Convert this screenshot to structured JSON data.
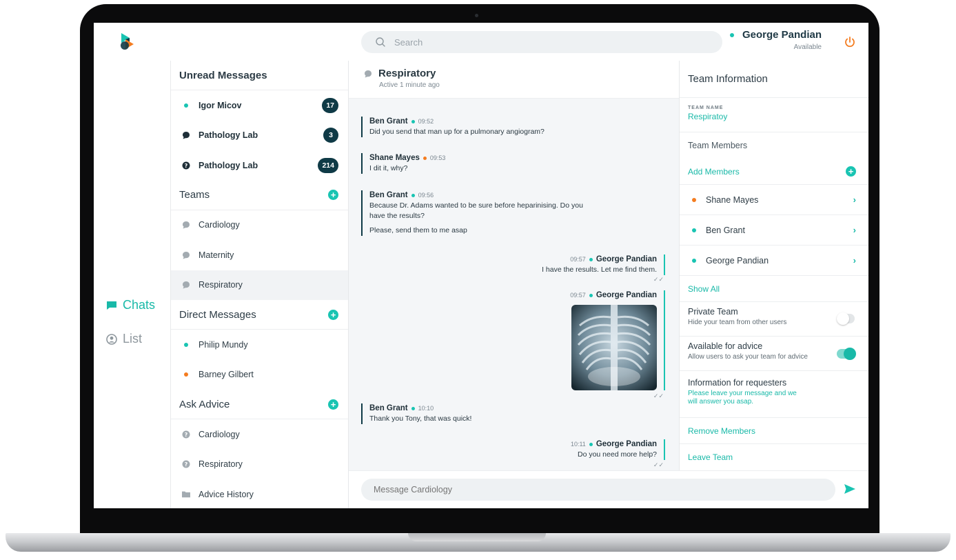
{
  "header": {
    "search_placeholder": "Search",
    "user_name": "George Pandian",
    "user_status": "Available"
  },
  "rail": {
    "chats_label": "Chats",
    "list_label": "List"
  },
  "unread": {
    "title": "Unread Messages",
    "items": [
      {
        "label": "Igor Micov",
        "badge": "17",
        "icon": "teal-dot"
      },
      {
        "label": "Pathology Lab",
        "badge": "3",
        "icon": "chat-bubble-icon"
      },
      {
        "label": "Pathology Lab",
        "badge": "214",
        "icon": "question-icon"
      }
    ]
  },
  "teams": {
    "title": "Teams",
    "items": [
      {
        "label": "Cardiology"
      },
      {
        "label": "Maternity"
      },
      {
        "label": "Respiratory"
      }
    ]
  },
  "direct": {
    "title": "Direct Messages",
    "items": [
      {
        "label": "Philip Mundy",
        "status_color": "#19c4b2"
      },
      {
        "label": "Barney Gilbert",
        "status_color": "#f47c20"
      }
    ]
  },
  "advice": {
    "title": "Ask Advice",
    "items": [
      {
        "label": "Cardiology"
      },
      {
        "label": "Respiratory"
      },
      {
        "label": "Advice History"
      }
    ]
  },
  "chat": {
    "title": "Respiratory",
    "subtitle": "Active 1 minute ago",
    "messages": [
      {
        "author": "Ben Grant",
        "time": "09:52",
        "text": "Did you send that man up for a pulmonary angiogram?"
      },
      {
        "author": "Shane Mayes",
        "time": "09:53",
        "text": "I dit it, why?"
      },
      {
        "author": "Ben Grant",
        "time": "09:56",
        "text1": "Because Dr. Adams wanted to be sure before heparinising. Do you",
        "text2": "have the results?",
        "text3": "Please, send them to me asap"
      },
      {
        "author": "George Pandian",
        "time": "09:57",
        "text": "I have the results. Let me find them."
      },
      {
        "author": "George Pandian",
        "time": "09:57"
      },
      {
        "author": "Ben Grant",
        "time": "10:10",
        "text": "Thank you Tony, that was quick!"
      },
      {
        "author": "George Pandian",
        "time": "10:11",
        "text": "Do you need more help?"
      }
    ],
    "composer_placeholder": "Message Cardiology"
  },
  "info": {
    "title": "Team Information",
    "team_name_label": "TEAM NAME",
    "team_name": "Respiratoy",
    "members_title": "Team Members",
    "add_members": "Add Members",
    "members": [
      {
        "name": "Shane Mayes",
        "status_color": "#f47c20"
      },
      {
        "name": "Ben Grant",
        "status_color": "#19c4b2"
      },
      {
        "name": "George Pandian",
        "status_color": "#19c4b2"
      }
    ],
    "show_all": "Show All",
    "private_title": "Private Team",
    "private_desc": "Hide your team from other users",
    "private_on": false,
    "advice_title": "Available for advice",
    "advice_desc": "Allow users to ask your team for advice",
    "advice_on": true,
    "requesters_title": "Information for requesters",
    "requesters_text1": "Please leave your message and we",
    "requesters_text2": "will answer  you asap.",
    "remove_members": "Remove Members",
    "leave_team": "Leave Team"
  },
  "colors": {
    "accent": "#19c4b2",
    "dark": "#0f3a46",
    "away": "#f47c20",
    "power": "#f47c20"
  }
}
